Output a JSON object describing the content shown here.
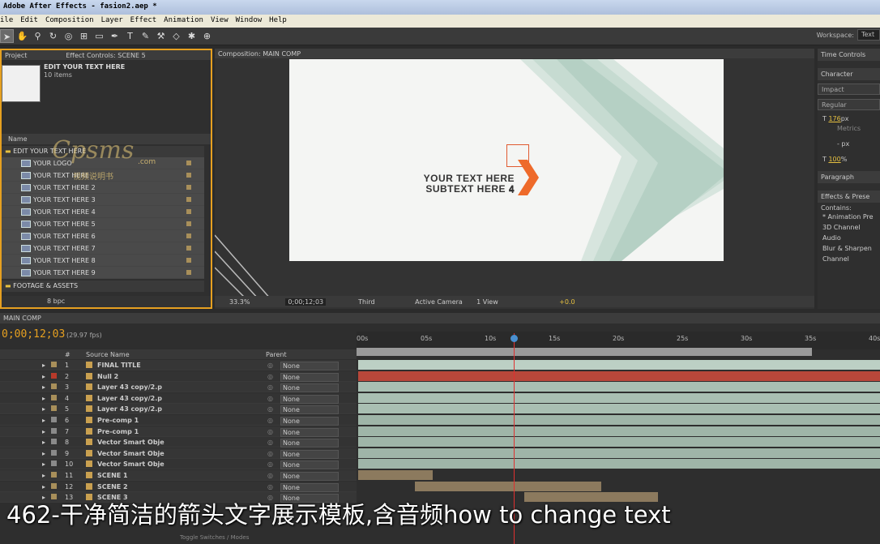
{
  "app": {
    "window_title": "Adobe After Effects - fasion2.aep *",
    "menu": [
      "ile",
      "Edit",
      "Composition",
      "Layer",
      "Effect",
      "Animation",
      "View",
      "Window",
      "Help"
    ],
    "workspace_label": "Workspace:",
    "workspace_value": "Text"
  },
  "project": {
    "tab_project": "Project",
    "tab_effects": "Effect Controls: SCENE 5",
    "selected_name": "EDIT YOUR TEXT HERE",
    "selected_count": "10 items",
    "col_name": "Name",
    "folder": "EDIT YOUR TEXT HERE",
    "items": [
      "YOUR LOGO",
      "YOUR TEXT HERE",
      "YOUR TEXT HERE 2",
      "YOUR TEXT HERE 3",
      "YOUR TEXT HERE 4",
      "YOUR TEXT HERE 5",
      "YOUR TEXT HERE 6",
      "YOUR TEXT HERE 7",
      "YOUR TEXT HERE 8",
      "YOUR TEXT HERE 9"
    ],
    "folder2": "FOOTAGE & ASSETS",
    "bpc": "8 bpc",
    "watermark": "Cpsms",
    "watermark_com": ".com",
    "watermark_sub": "视频说明书"
  },
  "composition": {
    "tab": "Composition: MAIN COMP",
    "text_line1": "YOUR TEXT HERE 4",
    "text_line2": "SUBTEXT HERE 4",
    "zoom": "33.3%",
    "timecode": "0;00;12;03",
    "resolution": "Third",
    "camera": "Active Camera",
    "views": "1 View",
    "exposure": "+0.0"
  },
  "right_panel": {
    "time_controls": "Time Controls",
    "character": "Character",
    "font": "Impact",
    "style": "Regular",
    "size": "176",
    "size_unit": "px",
    "kerning": "Metrics",
    "leading": "- px",
    "scale": "100",
    "scale_unit": "%",
    "paragraph": "Paragraph",
    "effects": "Effects & Prese",
    "contains": "Contains:",
    "fx_items": [
      "* Animation Pre",
      "3D Channel",
      "Audio",
      "Blur & Sharpen",
      "Channel"
    ]
  },
  "timeline": {
    "tab": "MAIN COMP",
    "timecode": "0;00;12;03",
    "fps": "(29.97 fps)",
    "col_num": "#",
    "col_source": "Source Name",
    "col_parent": "Parent",
    "ruler": [
      "00s",
      "05s",
      "10s",
      "15s",
      "20s",
      "25s",
      "30s",
      "35s",
      "40s"
    ],
    "parent_none": "None",
    "toggle": "Toggle Switches / Modes",
    "layers": [
      {
        "num": "1",
        "name": "FINAL TITLE",
        "color": "#a88f5a",
        "bar": "#bcd0c4"
      },
      {
        "num": "2",
        "name": "Null 2",
        "color": "#b83a2a",
        "bar": "#b8473a"
      },
      {
        "num": "3",
        "name": "Layer 43 copy/2.p",
        "color": "#a88f5a",
        "bar": "#a9bfb2"
      },
      {
        "num": "4",
        "name": "Layer 43 copy/2.p",
        "color": "#a88f5a",
        "bar": "#a9bfb2"
      },
      {
        "num": "5",
        "name": "Layer 43 copy/2.p",
        "color": "#a88f5a",
        "bar": "#a9bfb2"
      },
      {
        "num": "6",
        "name": "Pre-comp 1",
        "color": "#8a8a8a",
        "bar": "#9fb5a8"
      },
      {
        "num": "7",
        "name": "Pre-comp 1",
        "color": "#8a8a8a",
        "bar": "#9fb5a8"
      },
      {
        "num": "8",
        "name": "Vector Smart Obje",
        "color": "#8a8a8a",
        "bar": "#9fb5a8"
      },
      {
        "num": "9",
        "name": "Vector Smart Obje",
        "color": "#8a8a8a",
        "bar": "#9fb5a8"
      },
      {
        "num": "10",
        "name": "Vector Smart Obje",
        "color": "#8a8a8a",
        "bar": "#9fb5a8"
      },
      {
        "num": "11",
        "name": "SCENE 1",
        "color": "#a88f5a",
        "bar": "#8c7a5e"
      },
      {
        "num": "12",
        "name": "SCENE 2",
        "color": "#a88f5a",
        "bar": "#8c7a5e"
      },
      {
        "num": "13",
        "name": "SCENE 3",
        "color": "#a88f5a",
        "bar": "#8c7a5e"
      }
    ]
  },
  "subtitle": "462-干净简洁的箭头文字展示模板,含音频how to change text"
}
